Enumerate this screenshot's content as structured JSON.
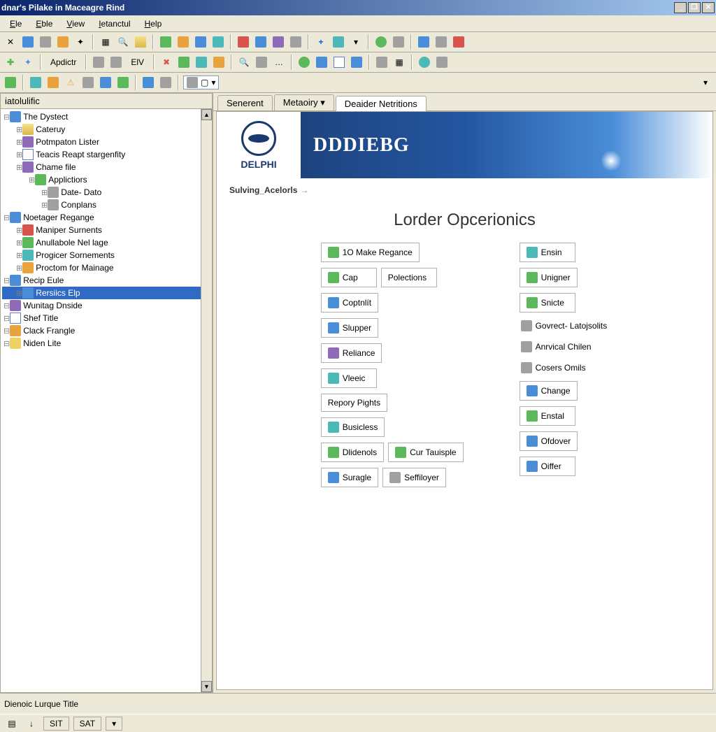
{
  "window": {
    "title": "dnar's Pilake in Maceagre Rind"
  },
  "menu": {
    "items": [
      "Ele",
      "Eble",
      "View",
      "Ietanctul",
      "Help"
    ]
  },
  "toolbar2": {
    "label_apdictr": "Apdictr",
    "label_elv": "ElV"
  },
  "left_panel": {
    "title": "iatolulific"
  },
  "tree": [
    {
      "label": "The Dystect",
      "indent": 0,
      "icon": "i-blue"
    },
    {
      "label": "Cateruy",
      "indent": 1,
      "icon": "i-folder"
    },
    {
      "label": "Potmpaton Lister",
      "indent": 1,
      "icon": "i-purple"
    },
    {
      "label": "Teacis Reapt stargenfity",
      "indent": 1,
      "icon": "i-doc"
    },
    {
      "label": "Chame file",
      "indent": 1,
      "icon": "i-purple"
    },
    {
      "label": "Applictiors",
      "indent": 2,
      "icon": "i-green"
    },
    {
      "label": "Date- Dato",
      "indent": 3,
      "icon": "i-gray"
    },
    {
      "label": "Conplans",
      "indent": 3,
      "icon": "i-gray"
    },
    {
      "label": "Noetager Regange",
      "indent": 0,
      "icon": "i-blue"
    },
    {
      "label": "Maniper Surnents",
      "indent": 1,
      "icon": "i-red"
    },
    {
      "label": "Anullabole Nel lage",
      "indent": 1,
      "icon": "i-green"
    },
    {
      "label": "Progicer Sornements",
      "indent": 1,
      "icon": "i-teal"
    },
    {
      "label": "Proctom for Mainage",
      "indent": 1,
      "icon": "i-orange"
    },
    {
      "label": "Recip Eule",
      "indent": 0,
      "icon": "i-blue"
    },
    {
      "label": "Rersiics Elp",
      "indent": 1,
      "icon": "i-blue",
      "selected": true
    },
    {
      "label": "Wunitag Dnside",
      "indent": 0,
      "icon": "i-purple"
    },
    {
      "label": "Shef Title",
      "indent": 0,
      "icon": "i-doc"
    },
    {
      "label": "Clack Frangle",
      "indent": 0,
      "icon": "i-orange"
    },
    {
      "label": "Niden Lite",
      "indent": 0,
      "icon": "i-yellow"
    }
  ],
  "tabs": [
    {
      "label": "Senerent",
      "active": false
    },
    {
      "label": "Metaoiry ▾",
      "active": false
    },
    {
      "label": "Deaider Netritions",
      "active": true
    }
  ],
  "banner": {
    "logo_text": "DELPHI",
    "title": "DDDIEBG"
  },
  "breadcrumb": {
    "text": "Sulving_Acelorls",
    "arrow": "→"
  },
  "page": {
    "heading": "Lorder Opcerionics"
  },
  "cards_center": [
    {
      "type": "row",
      "items": [
        {
          "icon": "i-green",
          "label": "1O Make Regance"
        }
      ]
    },
    {
      "type": "row",
      "items": [
        {
          "icon": "i-green",
          "label": "Cap"
        },
        {
          "icon": "",
          "label": "Polections"
        }
      ]
    },
    {
      "type": "btn",
      "icon": "i-blue",
      "label": "Coptnlít"
    },
    {
      "type": "btn",
      "icon": "i-blue",
      "label": "Slupper"
    },
    {
      "type": "btn",
      "icon": "i-purple",
      "label": "Reliance"
    },
    {
      "type": "btn",
      "icon": "i-teal",
      "label": "Vleeic"
    },
    {
      "type": "btn",
      "icon": "",
      "label": "Repory Pights"
    },
    {
      "type": "btn",
      "icon": "i-teal",
      "label": "Busicless"
    },
    {
      "type": "row",
      "items": [
        {
          "icon": "i-green",
          "label": "Dlidenols"
        },
        {
          "icon": "i-green",
          "label": "Cur Tauisple"
        }
      ]
    },
    {
      "type": "row",
      "items": [
        {
          "icon": "i-blue",
          "label": "Suragle"
        },
        {
          "icon": "i-gray",
          "label": "Seffiloyer"
        }
      ]
    }
  ],
  "cards_right": [
    {
      "type": "btn",
      "icon": "i-teal",
      "label": "Ensin"
    },
    {
      "type": "btn",
      "icon": "i-green",
      "label": "Unigner"
    },
    {
      "type": "btn",
      "icon": "i-green",
      "label": "Snicte"
    },
    {
      "type": "plain",
      "icon": "i-gray",
      "label": "Govrect- Latojsolits"
    },
    {
      "type": "plain",
      "icon": "i-gray",
      "label": "Anrvical Chilen"
    },
    {
      "type": "plain",
      "icon": "i-gray",
      "label": "Cosers Omils"
    },
    {
      "type": "btn",
      "icon": "i-blue",
      "label": "Change"
    },
    {
      "type": "btn",
      "icon": "i-green",
      "label": "Enstal"
    },
    {
      "type": "btn",
      "icon": "i-blue",
      "label": "Ofdover"
    },
    {
      "type": "btn",
      "icon": "i-blue",
      "label": "Oiffer"
    }
  ],
  "status": {
    "label": "Dienoic Lurque Title",
    "btn1": "SIT",
    "btn2": "SAT"
  }
}
